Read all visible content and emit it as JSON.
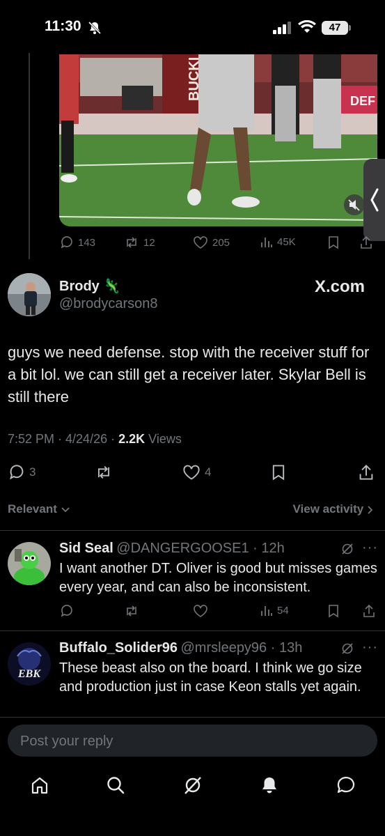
{
  "status_bar": {
    "time": "11:30",
    "battery": "47"
  },
  "quoted_post": {
    "stats": {
      "replies": "143",
      "reposts": "12",
      "likes": "205",
      "views": "45K"
    }
  },
  "main_post": {
    "name": "Brody",
    "handle": "@brodycarson8",
    "brand": "X.com",
    "text": "guys we need defense. stop with the receiver stuff for a bit lol. we can still get a receiver later. Skylar Bell is still there",
    "time": "7:52 PM · 4/24/26 ·",
    "views_count": "2.2K",
    "views_label": "Views",
    "stats": {
      "replies": "3",
      "likes": "4"
    }
  },
  "sort": {
    "label": "Relevant",
    "view_activity": "View activity"
  },
  "replies": [
    {
      "name": "Sid Seal",
      "handle": "@DANGERGOOSE1 · 12h",
      "text": "I want another DT. Oliver is good but misses games every year, and can also be inconsistent.",
      "views": "54"
    },
    {
      "name": "Buffalo_Solider96",
      "handle": "@mrsleepy96 · 13h",
      "text": "These beast also on the board. I think we go size and production just in case Keon stalls yet again.",
      "avatar_text": "EBK"
    }
  ],
  "reply_box": {
    "placeholder": "Post your reply"
  },
  "colors": {
    "background": "#000000",
    "muted": "#71767b",
    "text": "#e7e9ea",
    "divider": "#2f3336"
  }
}
